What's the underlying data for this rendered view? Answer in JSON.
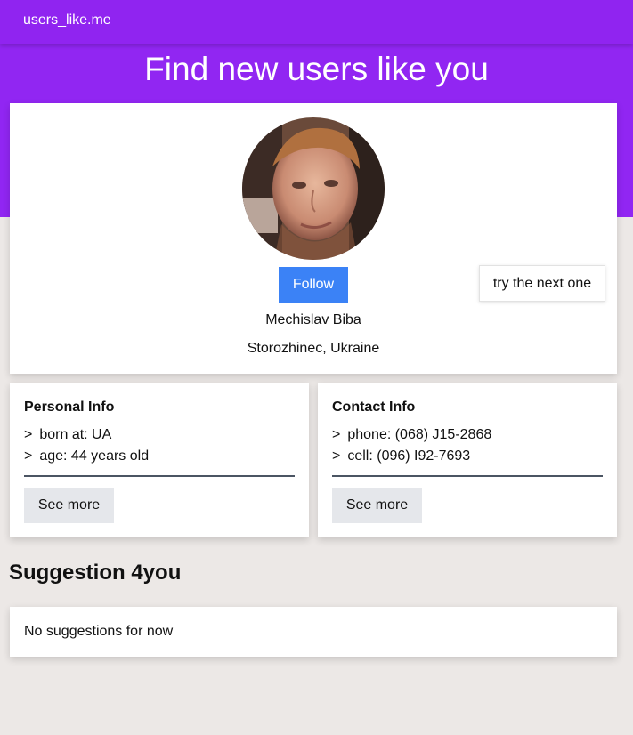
{
  "navbar": {
    "brand": "users_like.me"
  },
  "hero": {
    "title": "Find new users like you"
  },
  "profile": {
    "avatar_alt": "profile photo",
    "follow_label": "Follow",
    "next_label": "try the next one",
    "name": "Mechislav Biba",
    "location": "Storozhinec, Ukraine"
  },
  "personal_info": {
    "title": "Personal Info",
    "items": [
      {
        "marker": ">",
        "text": "born at: UA"
      },
      {
        "marker": ">",
        "text": "age: 44 years old"
      }
    ],
    "see_more_label": "See more"
  },
  "contact_info": {
    "title": "Contact Info",
    "items": [
      {
        "marker": ">",
        "text": "phone: (068) J15-2868"
      },
      {
        "marker": ">",
        "text": "cell: (096) I92-7693"
      }
    ],
    "see_more_label": "See more"
  },
  "suggestions": {
    "title": "Suggestion 4you",
    "empty_text": "No suggestions for now"
  },
  "colors": {
    "brand_purple": "#9126f2",
    "follow_blue": "#3b82f6",
    "page_background": "#ece8e6"
  }
}
